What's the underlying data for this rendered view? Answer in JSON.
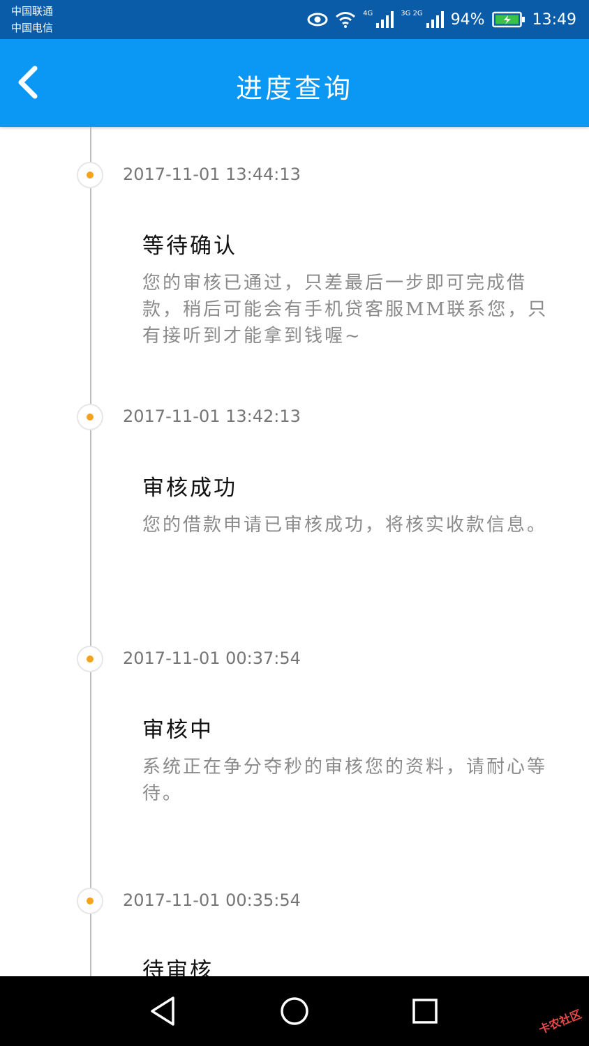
{
  "status_bar": {
    "carrier1": "中国联通",
    "carrier2": "中国电信",
    "net1": "4G",
    "net2": "3G 2G",
    "battery": "94%",
    "time": "13:49"
  },
  "header": {
    "title": "进度查询"
  },
  "timeline": [
    {
      "time": "2017-11-01 13:44:13",
      "title": "等待确认",
      "desc": "您的审核已通过，只差最后一步即可完成借款，稍后可能会有手机贷客服MM联系您，只有接听到才能拿到钱喔~"
    },
    {
      "time": "2017-11-01 13:42:13",
      "title": "审核成功",
      "desc": "您的借款申请已审核成功，将核实收款信息。"
    },
    {
      "time": "2017-11-01 00:37:54",
      "title": "审核中",
      "desc": "系统正在争分夺秒的审核您的资料，请耐心等待。"
    },
    {
      "time": "2017-11-01 00:35:54",
      "title": "待审核",
      "desc": ""
    }
  ],
  "watermark": "卡农社区",
  "colors": {
    "status_bar": "#0b5ca8",
    "app_bar": "#0b97f4",
    "dot": "#f7a21b",
    "line": "#bdbdbd"
  }
}
